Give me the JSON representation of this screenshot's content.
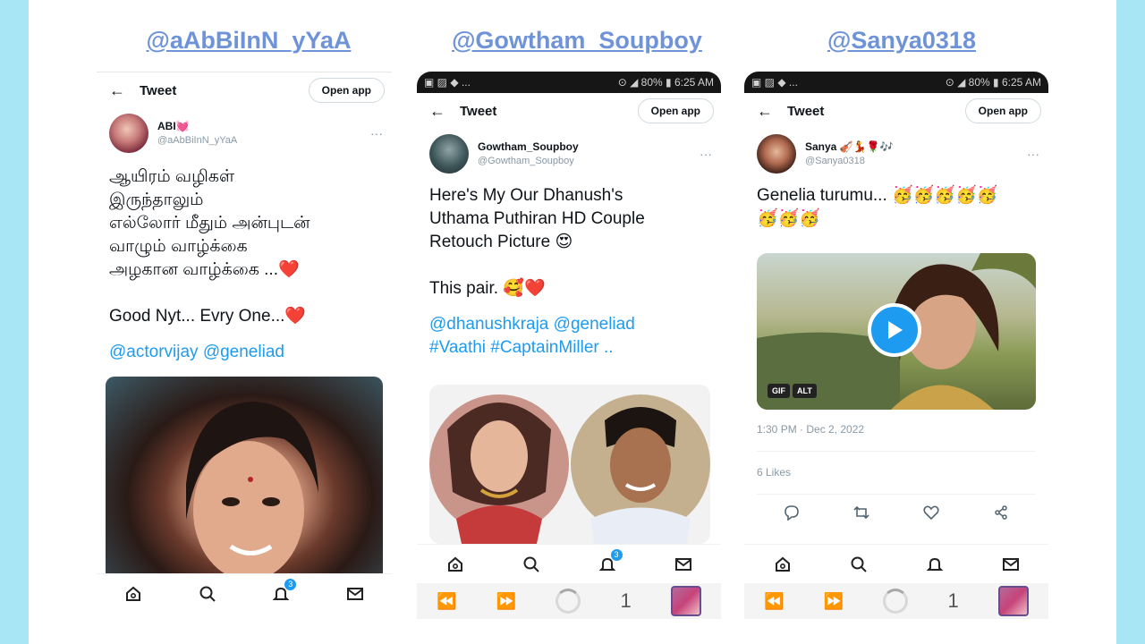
{
  "colors": {
    "side_bar": "#a8e6f5",
    "handle_text": "#6f93d8",
    "link": "#1d9bf0",
    "heart": "#e0245e",
    "play_button": "#1d9bf0",
    "status_bar": "#161616"
  },
  "panels": [
    {
      "handle_title": "@aAbBiInN_yYaA",
      "header": {
        "title": "Tweet",
        "open_app": "Open app",
        "back_icon": "arrow-left-icon"
      },
      "user": {
        "display_name": "ABI💓",
        "handle": "@aAbBiInN_yYaA"
      },
      "tweet_text": "ஆயிரம் வழிகள்\nஇருந்தாலும்\nஎல்லோர் மீதும் அன்புடன்\nவாழும் வாழ்க்கை\nஅழகான வாழ்க்கை ...❤️\n\nGood Nyt... Evry One...❤️",
      "mentions": "@actorvijay @geneliad",
      "nav_icons": [
        "home-icon",
        "search-icon",
        "bell-icon",
        "mail-icon"
      ],
      "notification_badge": "3"
    },
    {
      "handle_title": "@Gowtham_Soupboy",
      "status_bar": {
        "left": "▣ ▨ ◆ ...",
        "right": "⊙ ◢ 80% ▮ 6:25 AM"
      },
      "header": {
        "title": "Tweet",
        "open_app": "Open app",
        "back_icon": "arrow-left-icon"
      },
      "user": {
        "display_name": "Gowtham_Soupboy",
        "handle": "@Gowtham_Soupboy"
      },
      "tweet_text": "Here's My Our Dhanush's\nUthama Puthiran HD Couple\nRetouch Picture 😍\n\nThis pair. 🥰❤️",
      "mentions": "@dhanushkraja @geneliad\n#Vaathi #CaptainMiller ..",
      "nav_icons": [
        "home-icon",
        "search-icon",
        "bell-icon",
        "mail-icon"
      ],
      "notification_badge": "3",
      "browser": {
        "back": "⏪",
        "forward": "⏩",
        "tab_count": "1"
      }
    },
    {
      "handle_title": "@Sanya0318",
      "status_bar": {
        "left": "▣ ▨ ◆ ...",
        "right": "⊙ ◢ 80% ▮ 6:25 AM"
      },
      "header": {
        "title": "Tweet",
        "open_app": "Open app",
        "back_icon": "arrow-left-icon"
      },
      "user": {
        "display_name": "Sanya 🎻💃🌹🎶",
        "handle": "@Sanya0318"
      },
      "tweet_text": "Genelia turumu... 🥳🥳🥳🥳🥳\n🥳🥳🥳",
      "media_tags": [
        "GIF",
        "ALT"
      ],
      "timestamp": "1:30 PM · Dec 2, 2022",
      "likes": "6 Likes",
      "action_icons": [
        "reply-icon",
        "retweet-icon",
        "like-icon",
        "share-icon"
      ],
      "nav_icons": [
        "home-icon",
        "search-icon",
        "bell-icon",
        "mail-icon"
      ],
      "browser": {
        "back": "⏪",
        "forward": "⏩",
        "tab_count": "1"
      }
    }
  ]
}
